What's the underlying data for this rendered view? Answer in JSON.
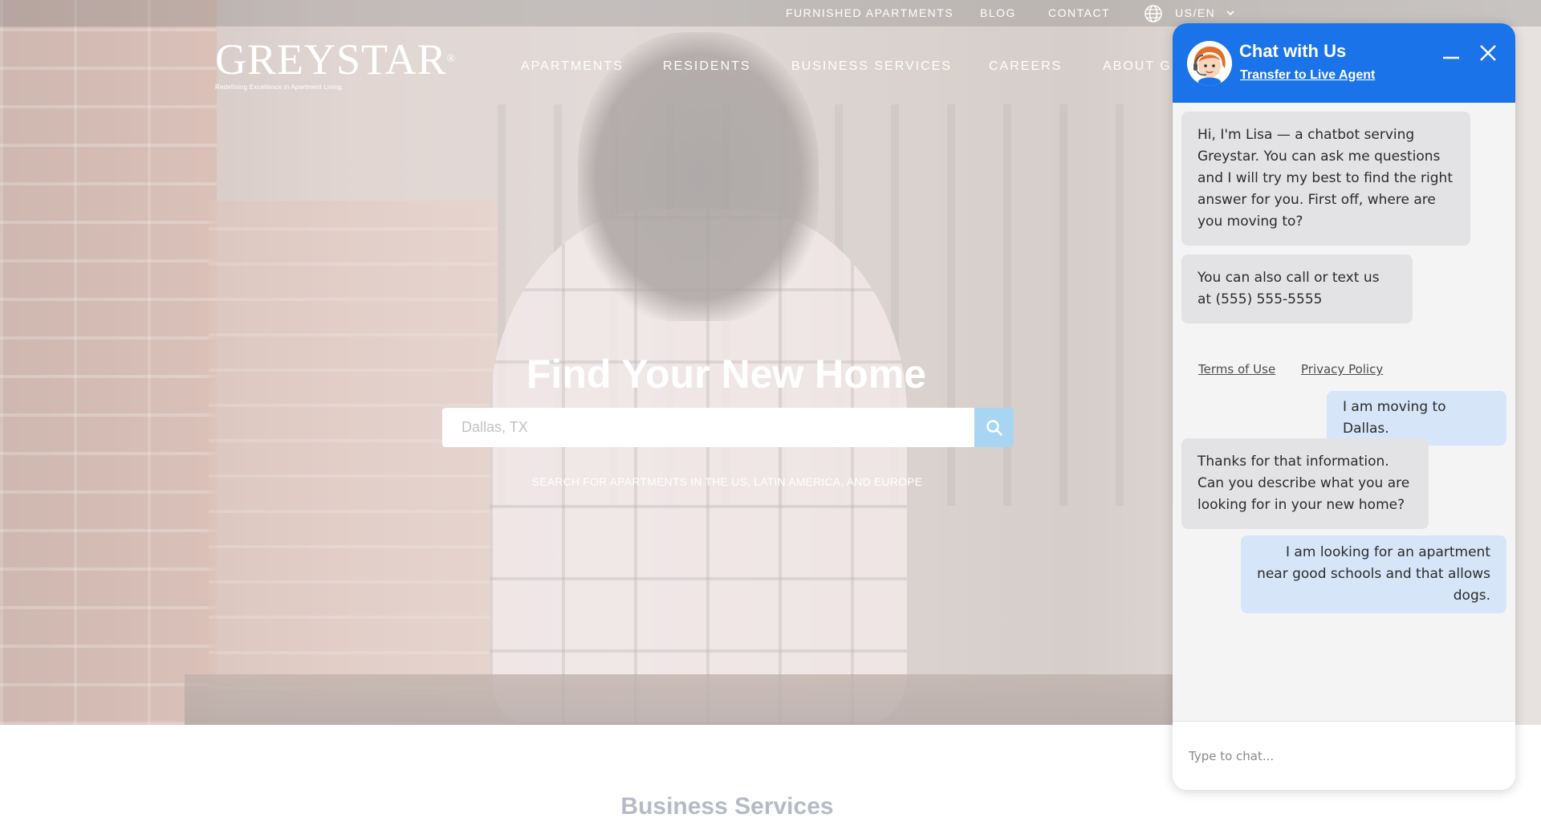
{
  "utility_nav": {
    "links": [
      "FURNISHED APARTMENTS",
      "BLOG",
      "CONTACT"
    ],
    "locale": "US/EN"
  },
  "logo": {
    "word": "GREYSTAR",
    "reg": "®",
    "tagline": "Redefining Excellence in Apartment Living."
  },
  "main_nav": [
    "APARTMENTS",
    "RESIDENTS",
    "BUSINESS SERVICES",
    "CAREERS",
    "ABOUT GR"
  ],
  "hero": {
    "title": "Find Your New Home",
    "search_value": "Dallas, TX",
    "subtitle": "SEARCH FOR APARTMENTS IN THE US, LATIN AMERICA, AND EUROPE"
  },
  "section": {
    "title": "Business Services"
  },
  "chat": {
    "title": "Chat with Us",
    "transfer_label": "Transfer to Live Agent",
    "messages": [
      "Hi, I'm Lisa — a chatbot serving Greystar. You can ask me questions and I will try my best to find the right answer for you. First off, where are you moving to?",
      "You can also call or text us at (555) 555-5555",
      "I am moving to Dallas.",
      "Thanks for that information. Can you describe what you are looking for in your new home?",
      "I am looking for an apartment near good schools and that allows dogs."
    ],
    "terms_label": "Terms of Use",
    "privacy_label": "Privacy Policy",
    "input_placeholder": "Type to chat...",
    "accent_color": "#1a73e8"
  }
}
